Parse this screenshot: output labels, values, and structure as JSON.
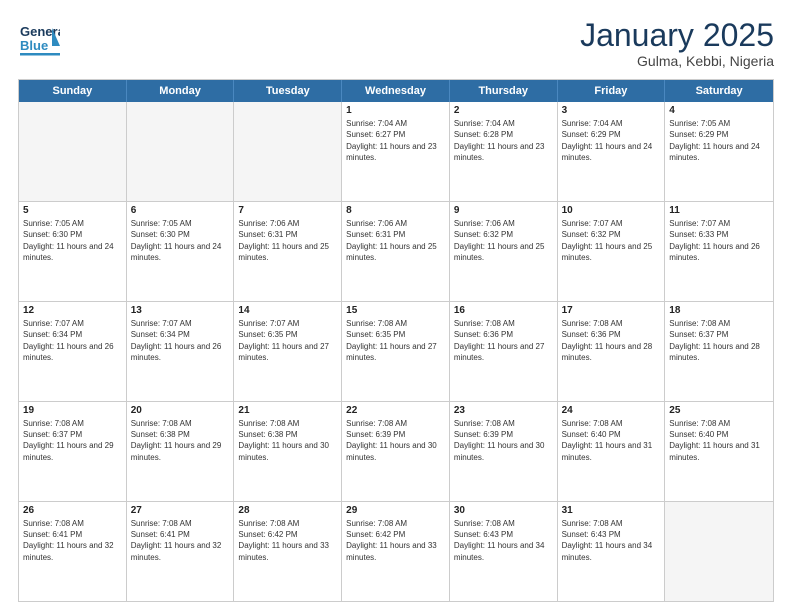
{
  "header": {
    "logo_general": "General",
    "logo_blue": "Blue",
    "title": "January 2025",
    "subtitle": "Gulma, Kebbi, Nigeria"
  },
  "calendar": {
    "days": [
      "Sunday",
      "Monday",
      "Tuesday",
      "Wednesday",
      "Thursday",
      "Friday",
      "Saturday"
    ],
    "weeks": [
      [
        {
          "day": "",
          "empty": true
        },
        {
          "day": "",
          "empty": true
        },
        {
          "day": "",
          "empty": true
        },
        {
          "day": "1",
          "sunrise": "Sunrise: 7:04 AM",
          "sunset": "Sunset: 6:27 PM",
          "daylight": "Daylight: 11 hours and 23 minutes."
        },
        {
          "day": "2",
          "sunrise": "Sunrise: 7:04 AM",
          "sunset": "Sunset: 6:28 PM",
          "daylight": "Daylight: 11 hours and 23 minutes."
        },
        {
          "day": "3",
          "sunrise": "Sunrise: 7:04 AM",
          "sunset": "Sunset: 6:29 PM",
          "daylight": "Daylight: 11 hours and 24 minutes."
        },
        {
          "day": "4",
          "sunrise": "Sunrise: 7:05 AM",
          "sunset": "Sunset: 6:29 PM",
          "daylight": "Daylight: 11 hours and 24 minutes."
        }
      ],
      [
        {
          "day": "5",
          "sunrise": "Sunrise: 7:05 AM",
          "sunset": "Sunset: 6:30 PM",
          "daylight": "Daylight: 11 hours and 24 minutes."
        },
        {
          "day": "6",
          "sunrise": "Sunrise: 7:05 AM",
          "sunset": "Sunset: 6:30 PM",
          "daylight": "Daylight: 11 hours and 24 minutes."
        },
        {
          "day": "7",
          "sunrise": "Sunrise: 7:06 AM",
          "sunset": "Sunset: 6:31 PM",
          "daylight": "Daylight: 11 hours and 25 minutes."
        },
        {
          "day": "8",
          "sunrise": "Sunrise: 7:06 AM",
          "sunset": "Sunset: 6:31 PM",
          "daylight": "Daylight: 11 hours and 25 minutes."
        },
        {
          "day": "9",
          "sunrise": "Sunrise: 7:06 AM",
          "sunset": "Sunset: 6:32 PM",
          "daylight": "Daylight: 11 hours and 25 minutes."
        },
        {
          "day": "10",
          "sunrise": "Sunrise: 7:07 AM",
          "sunset": "Sunset: 6:32 PM",
          "daylight": "Daylight: 11 hours and 25 minutes."
        },
        {
          "day": "11",
          "sunrise": "Sunrise: 7:07 AM",
          "sunset": "Sunset: 6:33 PM",
          "daylight": "Daylight: 11 hours and 26 minutes."
        }
      ],
      [
        {
          "day": "12",
          "sunrise": "Sunrise: 7:07 AM",
          "sunset": "Sunset: 6:34 PM",
          "daylight": "Daylight: 11 hours and 26 minutes."
        },
        {
          "day": "13",
          "sunrise": "Sunrise: 7:07 AM",
          "sunset": "Sunset: 6:34 PM",
          "daylight": "Daylight: 11 hours and 26 minutes."
        },
        {
          "day": "14",
          "sunrise": "Sunrise: 7:07 AM",
          "sunset": "Sunset: 6:35 PM",
          "daylight": "Daylight: 11 hours and 27 minutes."
        },
        {
          "day": "15",
          "sunrise": "Sunrise: 7:08 AM",
          "sunset": "Sunset: 6:35 PM",
          "daylight": "Daylight: 11 hours and 27 minutes."
        },
        {
          "day": "16",
          "sunrise": "Sunrise: 7:08 AM",
          "sunset": "Sunset: 6:36 PM",
          "daylight": "Daylight: 11 hours and 27 minutes."
        },
        {
          "day": "17",
          "sunrise": "Sunrise: 7:08 AM",
          "sunset": "Sunset: 6:36 PM",
          "daylight": "Daylight: 11 hours and 28 minutes."
        },
        {
          "day": "18",
          "sunrise": "Sunrise: 7:08 AM",
          "sunset": "Sunset: 6:37 PM",
          "daylight": "Daylight: 11 hours and 28 minutes."
        }
      ],
      [
        {
          "day": "19",
          "sunrise": "Sunrise: 7:08 AM",
          "sunset": "Sunset: 6:37 PM",
          "daylight": "Daylight: 11 hours and 29 minutes."
        },
        {
          "day": "20",
          "sunrise": "Sunrise: 7:08 AM",
          "sunset": "Sunset: 6:38 PM",
          "daylight": "Daylight: 11 hours and 29 minutes."
        },
        {
          "day": "21",
          "sunrise": "Sunrise: 7:08 AM",
          "sunset": "Sunset: 6:38 PM",
          "daylight": "Daylight: 11 hours and 30 minutes."
        },
        {
          "day": "22",
          "sunrise": "Sunrise: 7:08 AM",
          "sunset": "Sunset: 6:39 PM",
          "daylight": "Daylight: 11 hours and 30 minutes."
        },
        {
          "day": "23",
          "sunrise": "Sunrise: 7:08 AM",
          "sunset": "Sunset: 6:39 PM",
          "daylight": "Daylight: 11 hours and 30 minutes."
        },
        {
          "day": "24",
          "sunrise": "Sunrise: 7:08 AM",
          "sunset": "Sunset: 6:40 PM",
          "daylight": "Daylight: 11 hours and 31 minutes."
        },
        {
          "day": "25",
          "sunrise": "Sunrise: 7:08 AM",
          "sunset": "Sunset: 6:40 PM",
          "daylight": "Daylight: 11 hours and 31 minutes."
        }
      ],
      [
        {
          "day": "26",
          "sunrise": "Sunrise: 7:08 AM",
          "sunset": "Sunset: 6:41 PM",
          "daylight": "Daylight: 11 hours and 32 minutes."
        },
        {
          "day": "27",
          "sunrise": "Sunrise: 7:08 AM",
          "sunset": "Sunset: 6:41 PM",
          "daylight": "Daylight: 11 hours and 32 minutes."
        },
        {
          "day": "28",
          "sunrise": "Sunrise: 7:08 AM",
          "sunset": "Sunset: 6:42 PM",
          "daylight": "Daylight: 11 hours and 33 minutes."
        },
        {
          "day": "29",
          "sunrise": "Sunrise: 7:08 AM",
          "sunset": "Sunset: 6:42 PM",
          "daylight": "Daylight: 11 hours and 33 minutes."
        },
        {
          "day": "30",
          "sunrise": "Sunrise: 7:08 AM",
          "sunset": "Sunset: 6:43 PM",
          "daylight": "Daylight: 11 hours and 34 minutes."
        },
        {
          "day": "31",
          "sunrise": "Sunrise: 7:08 AM",
          "sunset": "Sunset: 6:43 PM",
          "daylight": "Daylight: 11 hours and 34 minutes."
        },
        {
          "day": "",
          "empty": true
        }
      ]
    ]
  }
}
